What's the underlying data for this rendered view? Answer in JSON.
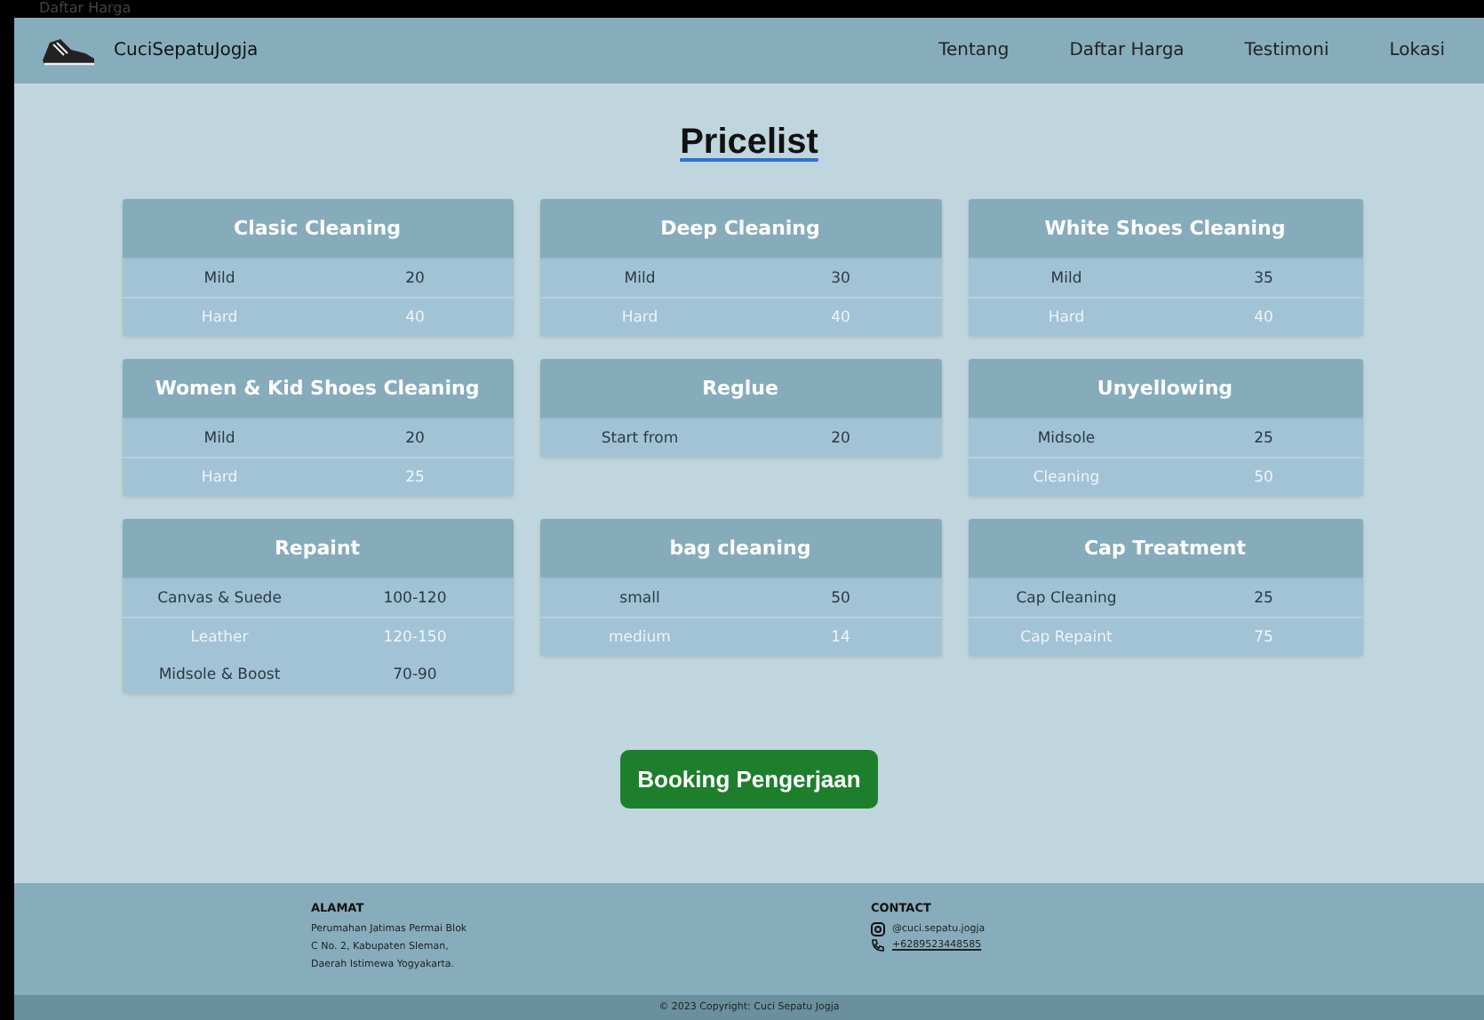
{
  "browser_tab": {
    "title": "Daftar Harga"
  },
  "navbar": {
    "brand": "CuciSepatuJogja",
    "links": [
      "Tentang",
      "Daftar Harga",
      "Testimoni",
      "Lokasi"
    ]
  },
  "page_title": "Pricelist",
  "price_cards": [
    {
      "title": "Clasic Cleaning",
      "rows": [
        {
          "label": "Mild",
          "price": "20"
        },
        {
          "label": "Hard",
          "price": "40"
        }
      ]
    },
    {
      "title": "Deep Cleaning",
      "rows": [
        {
          "label": "Mild",
          "price": "30"
        },
        {
          "label": "Hard",
          "price": "40"
        }
      ]
    },
    {
      "title": "White Shoes Cleaning",
      "rows": [
        {
          "label": "Mild",
          "price": "35"
        },
        {
          "label": "Hard",
          "price": "40"
        }
      ]
    },
    {
      "title": "Women & Kid Shoes Cleaning",
      "rows": [
        {
          "label": "Mild",
          "price": "20"
        },
        {
          "label": "Hard",
          "price": "25"
        }
      ]
    },
    {
      "title": "Reglue",
      "rows": [
        {
          "label": "Start from",
          "price": "20"
        }
      ]
    },
    {
      "title": "Unyellowing",
      "rows": [
        {
          "label": "Midsole",
          "price": "25"
        },
        {
          "label": "Cleaning",
          "price": "50"
        }
      ]
    },
    {
      "title": "Repaint",
      "rows": [
        {
          "label": "Canvas & Suede",
          "price": "100-120"
        },
        {
          "label": "Leather",
          "price": "120-150"
        },
        {
          "label": "Midsole & Boost",
          "price": "70-90"
        }
      ]
    },
    {
      "title": "bag cleaning",
      "rows": [
        {
          "label": "small",
          "price": "50"
        },
        {
          "label": "medium",
          "price": "14"
        }
      ]
    },
    {
      "title": "Cap Treatment",
      "rows": [
        {
          "label": "Cap Cleaning",
          "price": "25"
        },
        {
          "label": "Cap Repaint",
          "price": "75"
        }
      ]
    }
  ],
  "booking_button": "Booking Pengerjaan",
  "footer": {
    "address_heading": "ALAMAT",
    "address_lines": [
      "Perumahan Jatimas Permai Blok",
      "C No. 2, Kabupaten Sleman,",
      "Daerah Istimewa Yogyakarta."
    ],
    "contact_heading": "CONTACT",
    "instagram": "@cuci.sepatu.jogja",
    "phone": "+6289523448585",
    "copyright": "© 2023 Copyright: Cuci Sepatu Jogja"
  }
}
